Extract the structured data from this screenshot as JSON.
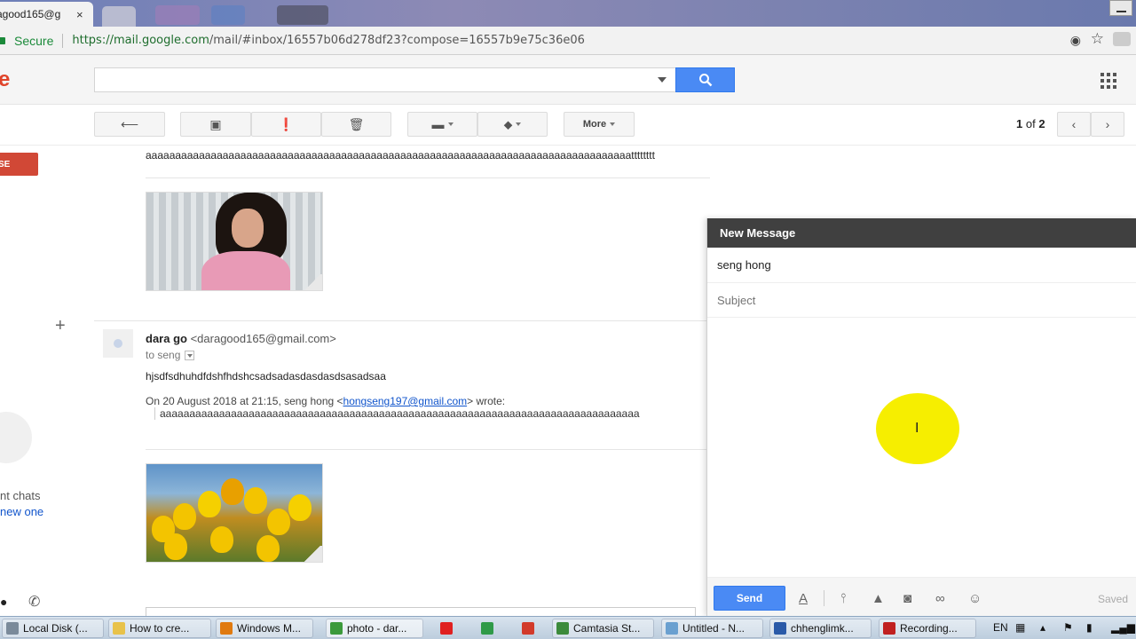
{
  "browser": {
    "active_tab_title": "agood165@g",
    "tab_close": "×",
    "secure_label": "Secure",
    "url_host": "https://mail.google.com",
    "url_path": "/mail/#inbox/16557b06d278df23?compose=16557b9e75c36e06"
  },
  "gmail": {
    "logo_fragment": "e",
    "search_placeholder": "",
    "toolbar": {
      "more_label": "More",
      "pager_current": "1",
      "pager_of": " of ",
      "pager_total": "2"
    },
    "sidebar": {
      "compose_fragment": "SE",
      "recent_chats": "nt chats",
      "new_one": "new one"
    },
    "thread": {
      "first_line": "aaaaaaaaaaaaaaaaaaaaaaaaaaaaaaaaaaaaaaaaaaaaaaaaaaaaaaaaaaaaaaaaaaaaaaaaaaaaaaaaaatttttttt",
      "sender_name": "dara go",
      "sender_email": "<daragood165@gmail.com>",
      "to_label": "to seng",
      "body": "hjsdfsdhuhdfdshfhdshcsadsadasdasdasdsasadsaa",
      "quote_prefix": "On 20 August 2018 at 21:15, seng hong <",
      "quote_email": "hongseng197@gmail.com",
      "quote_suffix": "> wrote:",
      "quote_text": "aaaaaaaaaaaaaaaaaaaaaaaaaaaaaaaaaaaaaaaaaaaaaaaaaaaaaaaaaaaaaaaaaaaaaaaaaaaaaaaaa"
    },
    "compose": {
      "title": "New Message",
      "to_value": "seng hong",
      "subject_placeholder": "Subject",
      "send_label": "Send",
      "saved_label": "Saved"
    }
  },
  "taskbar": {
    "items": [
      {
        "label": "Local Disk (...",
        "color": "#7a8a9a"
      },
      {
        "label": "How to cre...",
        "color": "#e8c24a"
      },
      {
        "label": "Windows M...",
        "color": "#e07a10"
      },
      {
        "label": "photo - dar...",
        "color": "#3b9a3b"
      },
      {
        "label": "",
        "color": "#e02020"
      },
      {
        "label": "",
        "color": "#2f9a48"
      },
      {
        "label": "",
        "color": "#d23a2a"
      },
      {
        "label": "Camtasia St...",
        "color": "#3b8a3b"
      },
      {
        "label": "Untitled - N...",
        "color": "#6aa0d0"
      },
      {
        "label": "chhenglimk...",
        "color": "#2a5aa8"
      },
      {
        "label": "Recording...",
        "color": "#c02020"
      }
    ],
    "lang": "EN"
  }
}
